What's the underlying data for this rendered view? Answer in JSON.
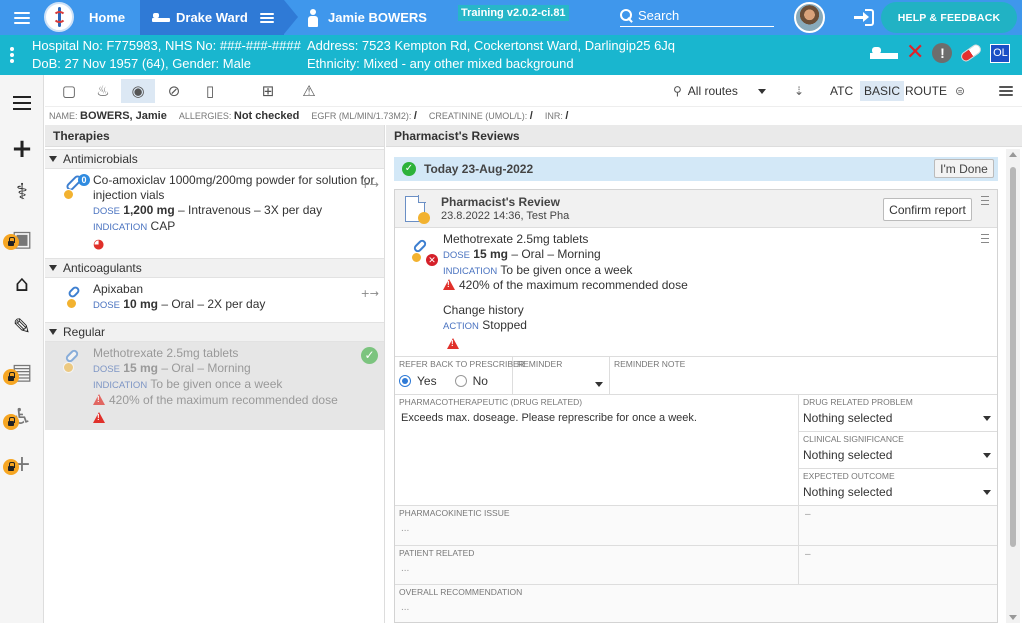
{
  "topbar": {
    "home_label": "Home",
    "ward_label": "Drake Ward",
    "patient_label": "Jamie BOWERS",
    "training_badge": "Training v2.0.2-ci.81",
    "search_placeholder": "Search",
    "help_label": "HELP & FEEDBACK"
  },
  "banner": {
    "hospital_line": "Hospital No: F775983, NHS No: ###-###-####",
    "dob_line": "DoB: 27 Nov 1957 (64), Gender: Male",
    "address_line": "Address: 7523 Kempton Rd, Cockertonst Ward, Darlingip25 6Jq",
    "ethnicity_line": "Ethnicity: Mixed - any other mixed background",
    "badge_ol": "OL"
  },
  "toolbar": {
    "routes_label": "All routes",
    "atc_label": "ATC",
    "basic_label": "BASIC",
    "route_label": "ROUTE"
  },
  "info": {
    "name_label": "NAME:",
    "name_value": "BOWERS, Jamie",
    "allergies_label": "ALLERGIES:",
    "allergies_value": "Not checked",
    "egfr_label": "EGFR (ML/MIN/1.73M2):",
    "egfr_value": "/",
    "creatinine_label": "CREATININE (UMOL/L):",
    "creatinine_value": "/",
    "inr_label": "INR:",
    "inr_value": "/"
  },
  "therapies": {
    "title": "Therapies",
    "sections": [
      {
        "heading": "Antimicrobials",
        "badge": "0",
        "name": "Co-amoxiclav 1000mg/200mg powder for solution for injection vials",
        "dose_label": "DOSE",
        "dose_value": "1,200 mg",
        "dose_rest": "– Intravenous – 3X per day",
        "indication_label": "INDICATION",
        "indication_value": "CAP"
      },
      {
        "heading": "Anticoagulants",
        "name": "Apixaban",
        "dose_label": "DOSE",
        "dose_value": "10 mg",
        "dose_rest": "– Oral – 2X per day"
      },
      {
        "heading": "Regular",
        "name": "Methotrexate 2.5mg tablets",
        "dose_label": "DOSE",
        "dose_value": "15 mg",
        "dose_rest": "– Oral – Morning",
        "indication_label": "INDICATION",
        "indication_value": "To be given once a week",
        "warning": "420% of the maximum recommended dose"
      }
    ]
  },
  "reviews": {
    "title": "Pharmacist's Reviews",
    "today_label": "Today 23-Aug-2022",
    "done_label": "I'm Done",
    "card": {
      "title": "Pharmacist's Review",
      "subtitle": "23.8.2022 14:36, Test Pha",
      "confirm_label": "Confirm report",
      "med_name": "Methotrexate 2.5mg tablets",
      "dose_label": "DOSE",
      "dose_value": "15 mg",
      "dose_rest": "– Oral – Morning",
      "indication_label": "INDICATION",
      "indication_value": "To be given once a week",
      "warning": "420% of the maximum recommended dose",
      "change_history": "Change history",
      "action_label": "ACTION",
      "action_value": "Stopped"
    },
    "form": {
      "refer_back_label": "REFER BACK TO PRESCRIBER",
      "yes_label": "Yes",
      "no_label": "No",
      "reminder_label": "REMINDER",
      "reminder_note_label": "REMINDER NOTE",
      "pharmacotherapeutic_label": "PHARMACOTHERAPEUTIC (DRUG RELATED)",
      "pharmacotherapeutic_value": "Exceeds max. doseage. Please represcribe for once a week.",
      "drug_problem_label": "DRUG RELATED PROBLEM",
      "drug_problem_value": "Nothing selected",
      "clinical_label": "CLINICAL SIGNIFICANCE",
      "clinical_value": "Nothing selected",
      "outcome_label": "EXPECTED OUTCOME",
      "outcome_value": "Nothing selected",
      "pharmacokinetic_label": "PHARMACOKINETIC ISSUE",
      "pharmacokinetic_value": "...",
      "pharmacokinetic_side": "–",
      "patient_label": "PATIENT RELATED",
      "patient_value": "...",
      "patient_side": "–",
      "overall_label": "OVERALL RECOMMENDATION",
      "overall_value": "..."
    }
  }
}
